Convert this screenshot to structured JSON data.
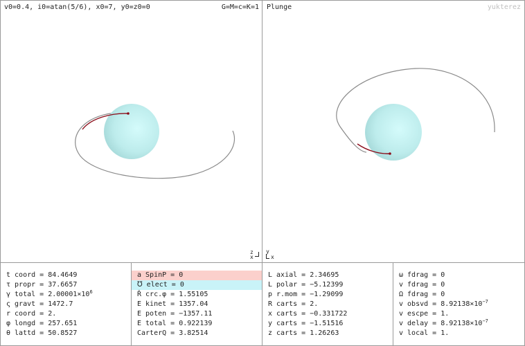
{
  "header": {
    "params": "v0=0.4, i0=atan(5/6), x0=7, y0=z0=0",
    "units": "G=M=c=K=1",
    "right_title": "Plunge",
    "watermark": "yukterez"
  },
  "axes": {
    "left_z": "z",
    "left_x": "x",
    "right_y": "y",
    "right_x": "x"
  },
  "colors": {
    "sphere": "#bfeeee",
    "orbit": "#8a8a8a",
    "trail": "#8b0d1a",
    "pink_highlight": "#fbd0cc",
    "cyan_highlight": "#c9f3f8"
  },
  "panels": {
    "col1": [
      {
        "label": "t coord",
        "value": "84.4649"
      },
      {
        "label": "τ propr",
        "value": "37.6657"
      },
      {
        "label": "γ total",
        "mantissa": "2.00001",
        "exp": "6"
      },
      {
        "label": "ς gravt",
        "value": "1472.7"
      },
      {
        "label": "r coord",
        "value": "2."
      },
      {
        "label": "φ longd",
        "value": "257.651"
      },
      {
        "label": "θ lattd",
        "value": "50.8527"
      }
    ],
    "col2": [
      {
        "label": "a SpinP",
        "value": "0"
      },
      {
        "label": "℧ elect",
        "value": "0"
      },
      {
        "label": "Ř crc.φ",
        "value": "1.55105"
      },
      {
        "label": "E kinet",
        "value": "1357.04"
      },
      {
        "label": "E poten",
        "value": "−1357.11"
      },
      {
        "label": "E total",
        "value": "0.922139"
      },
      {
        "label": "CarterQ",
        "value": "3.82514"
      }
    ],
    "col3": [
      {
        "label": "L axial",
        "value": "2.34695"
      },
      {
        "label": "L polar",
        "value": "−5.12399"
      },
      {
        "label": "p r.mom",
        "value": "−1.29099"
      },
      {
        "label": "R carts",
        "value": "2."
      },
      {
        "label": "x carts",
        "value": "−0.331722"
      },
      {
        "label": "y carts",
        "value": "−1.51516"
      },
      {
        "label": "z carts",
        "value": "1.26263"
      }
    ],
    "col4": [
      {
        "label": "ω fdrag",
        "value": "0"
      },
      {
        "label": "v fdrag",
        "value": "0"
      },
      {
        "label": "Ω fdrag",
        "value": "0"
      },
      {
        "label": "v obsvd",
        "mantissa": "8.92138",
        "exp": "−7"
      },
      {
        "label": "v escpe",
        "value": "1."
      },
      {
        "label": "v delay",
        "mantissa": "8.92138",
        "exp": "−7"
      },
      {
        "label": "v local",
        "value": "1."
      }
    ]
  }
}
